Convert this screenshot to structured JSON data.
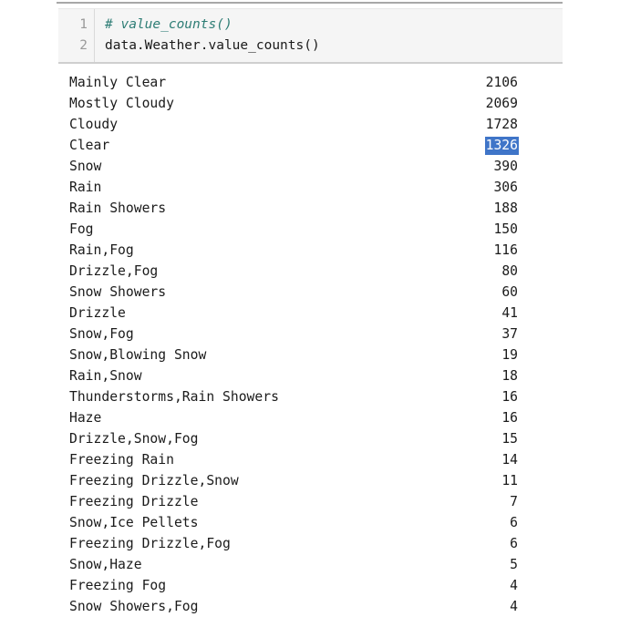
{
  "notebook": {
    "code_cell": {
      "line_numbers": [
        "1",
        "2"
      ],
      "lines": [
        {
          "text": "# value_counts()",
          "kind": "comment"
        },
        {
          "text": "data.Weather.value_counts()",
          "kind": "code"
        }
      ],
      "comment_color": "#2e7d75",
      "background_color": "#f5f5f5"
    },
    "output": {
      "selection_color": "#3f75c8",
      "selected_value": "1326",
      "rows": [
        {
          "label": "Mainly Clear",
          "value": "2106",
          "selected": false
        },
        {
          "label": "Mostly Cloudy",
          "value": "2069",
          "selected": false
        },
        {
          "label": "Cloudy",
          "value": "1728",
          "selected": false
        },
        {
          "label": "Clear",
          "value": "1326",
          "selected": true
        },
        {
          "label": "Snow",
          "value": "390",
          "selected": false
        },
        {
          "label": "Rain",
          "value": "306",
          "selected": false
        },
        {
          "label": "Rain Showers",
          "value": "188",
          "selected": false
        },
        {
          "label": "Fog",
          "value": "150",
          "selected": false
        },
        {
          "label": "Rain,Fog",
          "value": "116",
          "selected": false
        },
        {
          "label": "Drizzle,Fog",
          "value": "80",
          "selected": false
        },
        {
          "label": "Snow Showers",
          "value": "60",
          "selected": false
        },
        {
          "label": "Drizzle",
          "value": "41",
          "selected": false
        },
        {
          "label": "Snow,Fog",
          "value": "37",
          "selected": false
        },
        {
          "label": "Snow,Blowing Snow",
          "value": "19",
          "selected": false
        },
        {
          "label": "Rain,Snow",
          "value": "18",
          "selected": false
        },
        {
          "label": "Thunderstorms,Rain Showers",
          "value": "16",
          "selected": false
        },
        {
          "label": "Haze",
          "value": "16",
          "selected": false
        },
        {
          "label": "Drizzle,Snow,Fog",
          "value": "15",
          "selected": false
        },
        {
          "label": "Freezing Rain",
          "value": "14",
          "selected": false
        },
        {
          "label": "Freezing Drizzle,Snow",
          "value": "11",
          "selected": false
        },
        {
          "label": "Freezing Drizzle",
          "value": "7",
          "selected": false
        },
        {
          "label": "Snow,Ice Pellets",
          "value": "6",
          "selected": false
        },
        {
          "label": "Freezing Drizzle,Fog",
          "value": "6",
          "selected": false
        },
        {
          "label": "Snow,Haze",
          "value": "5",
          "selected": false
        },
        {
          "label": "Freezing Fog",
          "value": "4",
          "selected": false
        },
        {
          "label": "Snow Showers,Fog",
          "value": "4",
          "selected": false
        }
      ]
    }
  }
}
